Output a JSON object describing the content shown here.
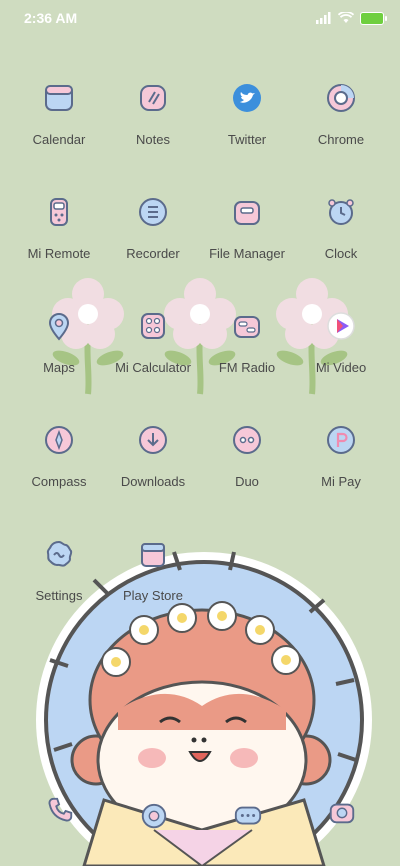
{
  "status_bar": {
    "time": "2:36 AM"
  },
  "apps": [
    {
      "name": "calendar",
      "label": "Calendar",
      "icon": "calendar-icon"
    },
    {
      "name": "notes",
      "label": "Notes",
      "icon": "notes-icon"
    },
    {
      "name": "twitter",
      "label": "Twitter",
      "icon": "twitter-bird-icon"
    },
    {
      "name": "chrome",
      "label": "Chrome",
      "icon": "chrome-icon"
    },
    {
      "name": "mi-remote",
      "label": "Mi Remote",
      "icon": "remote-icon"
    },
    {
      "name": "recorder",
      "label": "Recorder",
      "icon": "recorder-icon"
    },
    {
      "name": "file-manager",
      "label": "File Manager",
      "icon": "folder-icon"
    },
    {
      "name": "clock",
      "label": "Clock",
      "icon": "alarm-clock-icon"
    },
    {
      "name": "maps",
      "label": "Maps",
      "icon": "map-pin-icon"
    },
    {
      "name": "mi-calculator",
      "label": "Mi Calculator",
      "icon": "calculator-icon"
    },
    {
      "name": "fm-radio",
      "label": "FM Radio",
      "icon": "radio-icon"
    },
    {
      "name": "mi-video",
      "label": "Mi Video",
      "icon": "play-icon"
    },
    {
      "name": "compass",
      "label": "Compass",
      "icon": "compass-icon"
    },
    {
      "name": "downloads",
      "label": "Downloads",
      "icon": "download-icon"
    },
    {
      "name": "duo",
      "label": "Duo",
      "icon": "video-call-icon"
    },
    {
      "name": "mi-pay",
      "label": "Mi Pay",
      "icon": "pay-icon"
    },
    {
      "name": "settings",
      "label": "Settings",
      "icon": "gear-icon"
    },
    {
      "name": "play-store",
      "label": "Play Store",
      "icon": "play-store-icon"
    }
  ],
  "dock": [
    {
      "name": "phone",
      "icon": "phone-icon"
    },
    {
      "name": "browser",
      "icon": "browser-icon"
    },
    {
      "name": "messages",
      "icon": "chat-bubble-icon"
    },
    {
      "name": "camera",
      "icon": "camera-icon"
    }
  ],
  "colors": {
    "background": "#cfdcc0",
    "icon_outline": "#5b6b8c",
    "pink": "#f6c8d8",
    "blue": "#bcd6f3",
    "twitter_blue": "#3c8fdc",
    "battery": "#6fcf3f"
  }
}
